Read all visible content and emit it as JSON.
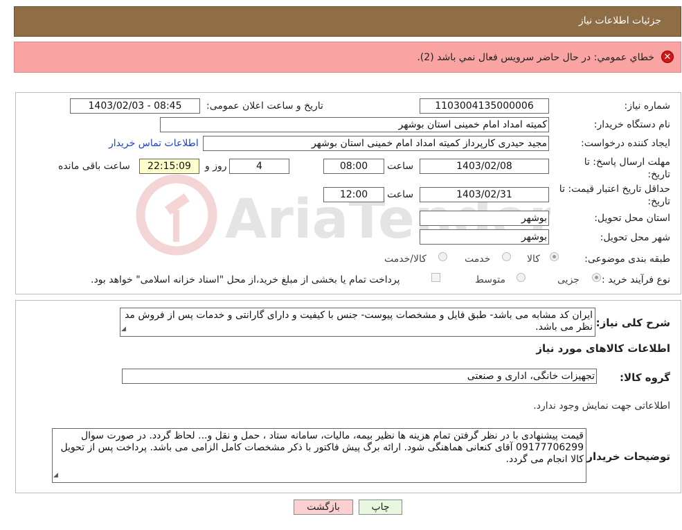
{
  "header": {
    "title": "جزئیات اطلاعات نیاز"
  },
  "error": {
    "message": "خطاي عمومي: در حال حاضر سرويس فعال نمي باشد (2)."
  },
  "watermark": {
    "text": "AriaTender.neT"
  },
  "form": {
    "need_number_label": "شماره نیاز:",
    "need_number": "1103004135000006",
    "announce_label": "تاریخ و ساعت اعلان عمومی:",
    "announce_value": "1403/02/03 - 08:45",
    "buyer_org_label": "نام دستگاه خریدار:",
    "buyer_org": "کمیته امداد امام خمینی استان بوشهر",
    "creator_label": "ایجاد کننده درخواست:",
    "creator": "مجید حیدری کارپرداز کمیته امداد امام خمینی استان بوشهر",
    "contact_link": "اطلاعات تماس خریدار",
    "deadline_label": "مهلت ارسال پاسخ: تا تاریخ:",
    "deadline_date": "1403/02/08",
    "time_label": "ساعت",
    "deadline_time": "08:00",
    "days": "4",
    "days_label": "روز و",
    "remaining": "22:15:09",
    "remaining_label": "ساعت باقی مانده",
    "validity_label": "حداقل تاریخ اعتبار قیمت: تا تاریخ:",
    "validity_date": "1403/02/31",
    "validity_time": "12:00",
    "province_label": "استان محل تحویل:",
    "province": "بوشهر",
    "city_label": "شهر محل تحویل:",
    "city": "بوشهر",
    "category_label": "طبقه بندی موضوعی:",
    "category_options": [
      "کالا",
      "خدمت",
      "کالا/خدمت"
    ],
    "process_label": "نوع فرآیند خرید :",
    "process_options": [
      "جزیی",
      "متوسط"
    ],
    "payment_note": "پرداخت تمام یا بخشی از مبلغ خرید،از محل \"اسناد خزانه اسلامی\" خواهد بود."
  },
  "details": {
    "summary_label": "شرح کلی نیاز:",
    "summary": "ایران کد مشابه می باشد- طبق فایل و مشخصات پیوست- جنس با کیفیت و دارای گارانتی و خدمات پس از فروش مد نظر می باشد.",
    "goods_heading": "اطلاعات کالاهای مورد نیاز",
    "goods_group_label": "گروه کالا:",
    "goods_group": "تجهیزات خانگی، اداری و صنعتی",
    "no_info": "اطلاعاتی جهت نمایش وجود ندارد.",
    "buyer_notes_label": "توضیحات خریدار:",
    "buyer_notes": "قیمت پیشنهادی با در نظر گرفتن تمام هزینه ها نظیر بیمه، مالیات، سامانه ستاد ، حمل و نقل و... لحاظ گردد. در صورت سوال 09177706299 آقای کنعانی هماهنگی شود. ارائه برگ پیش فاکتور با ذکر مشخصات کامل الزامی می باشد. پرداخت پس از تحویل کالا انجام می گردد."
  },
  "buttons": {
    "print": "چاپ",
    "back": "بازگشت"
  },
  "colors": {
    "header_bg": "#8f6d45",
    "error_bg": "#f9a3a3",
    "print_btn": "#e8f8e0",
    "back_btn": "#fbd0d0"
  }
}
